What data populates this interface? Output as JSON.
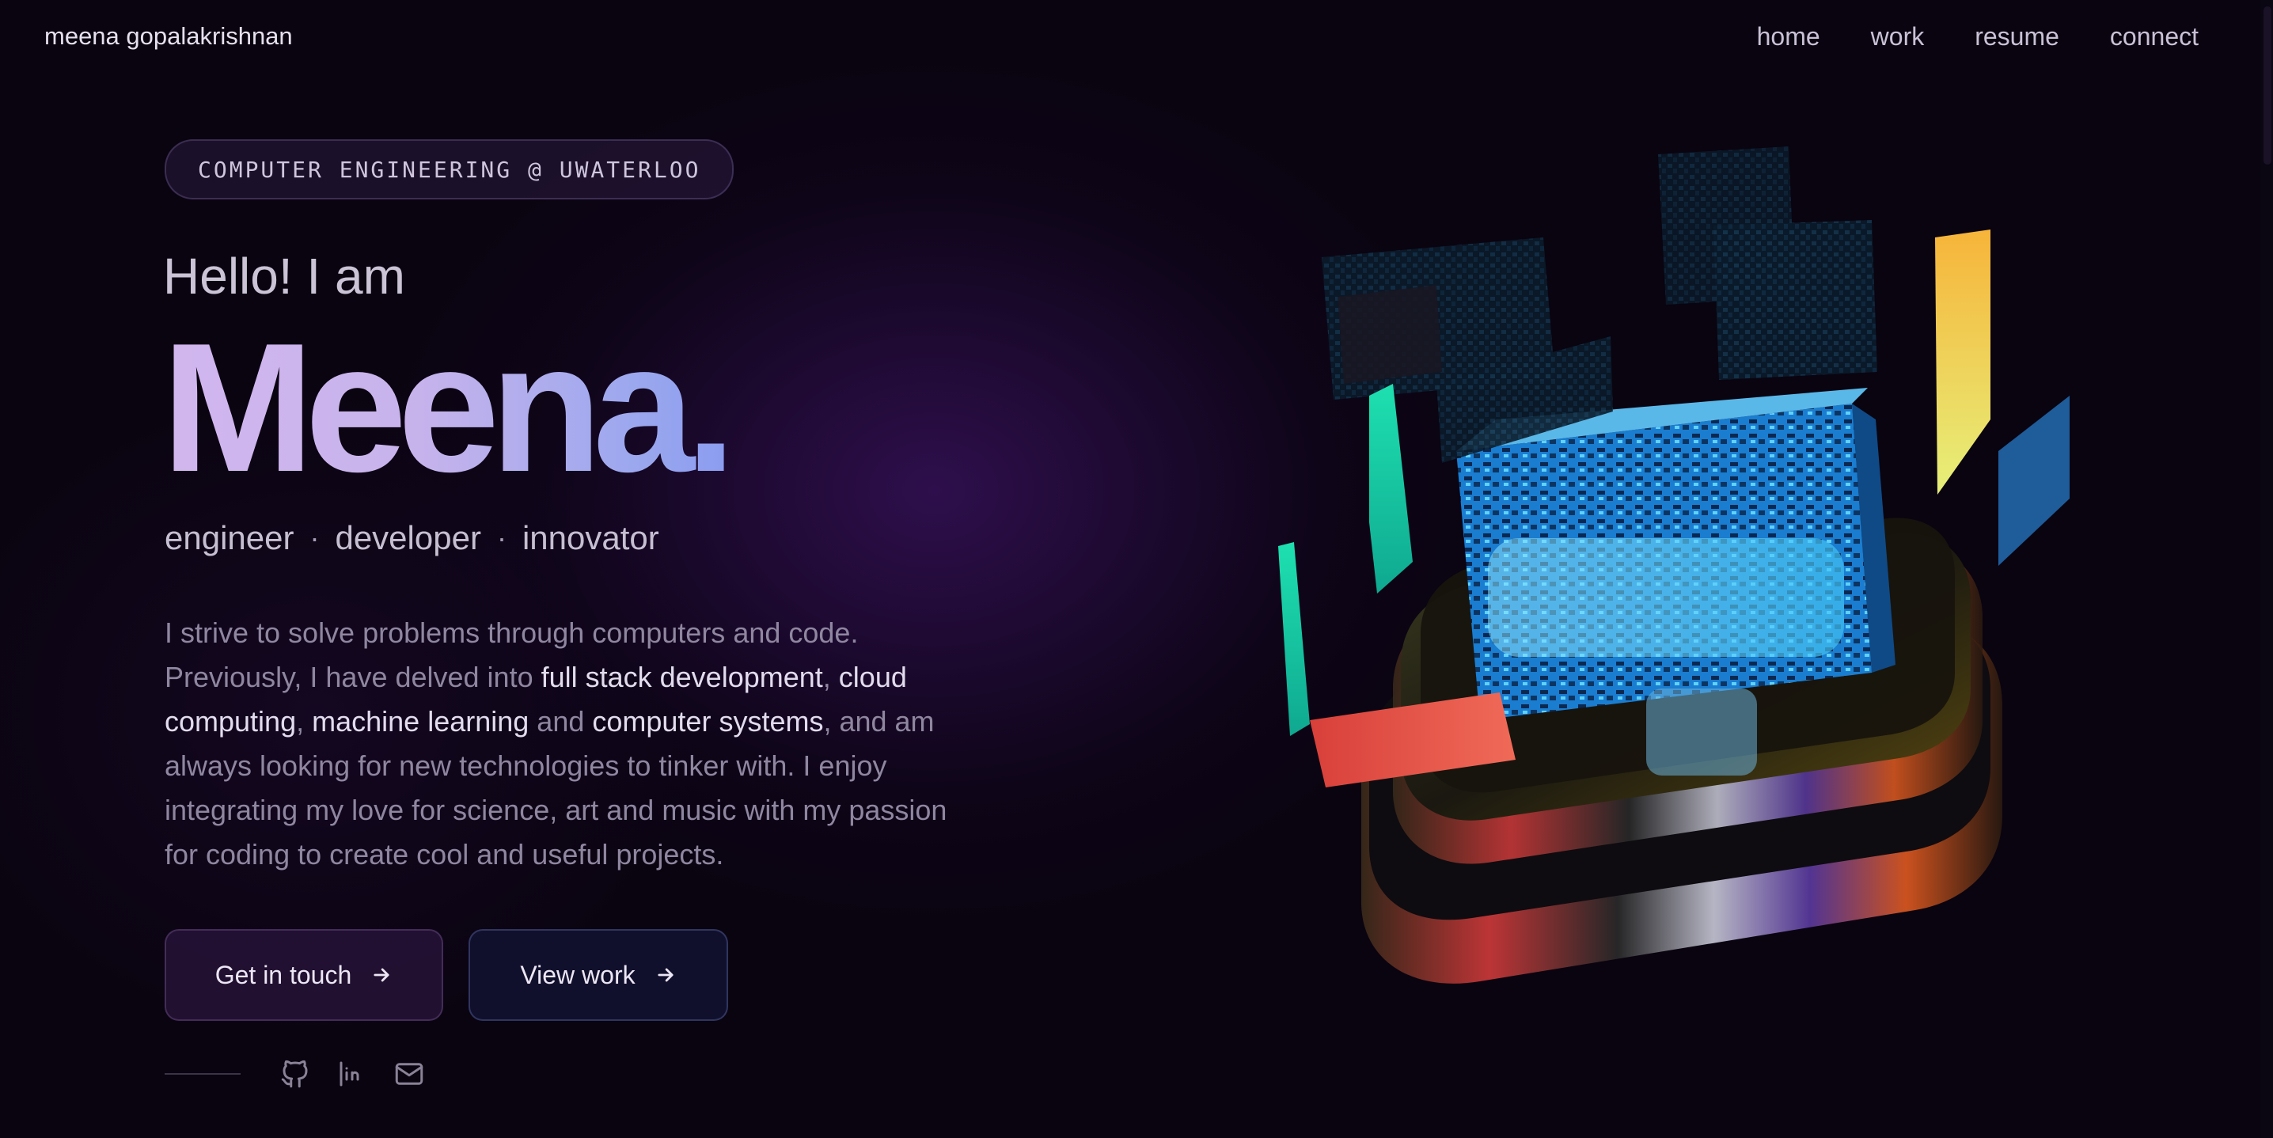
{
  "nav": {
    "brand": "meena gopalakrishnan",
    "links": [
      "home",
      "work",
      "resume",
      "connect"
    ]
  },
  "hero": {
    "badge": "COMPUTER ENGINEERING @ UWATERLOO",
    "greeting": "Hello! I am",
    "name": "Meena.",
    "roles": [
      "engineer",
      "developer",
      "innovator"
    ],
    "role_separator": "·",
    "about": {
      "p1": "I strive to solve problems through computers and code. Previously, I have delved into ",
      "hl1": "full stack development",
      "c1": ", ",
      "hl2": "cloud computing",
      "c2": ", ",
      "hl3": "machine learning",
      "and": " and ",
      "hl4": "computer systems",
      "p2": ", and am always looking for new technologies to tinker with. I enjoy integrating my love for science, art and music with my passion for coding to create cool and useful projects."
    },
    "buttons": {
      "contact": "Get in touch",
      "work": "View work"
    },
    "social_icons": [
      "github-icon",
      "linkedin-icon",
      "mail-icon"
    ]
  },
  "colors": {
    "background": "#0a0410",
    "glow": "#3a1260",
    "name_gradient_start": "#d2b6ee",
    "name_gradient_end": "#8b9cf0"
  },
  "illustration": "3d-chip-cube-icon"
}
